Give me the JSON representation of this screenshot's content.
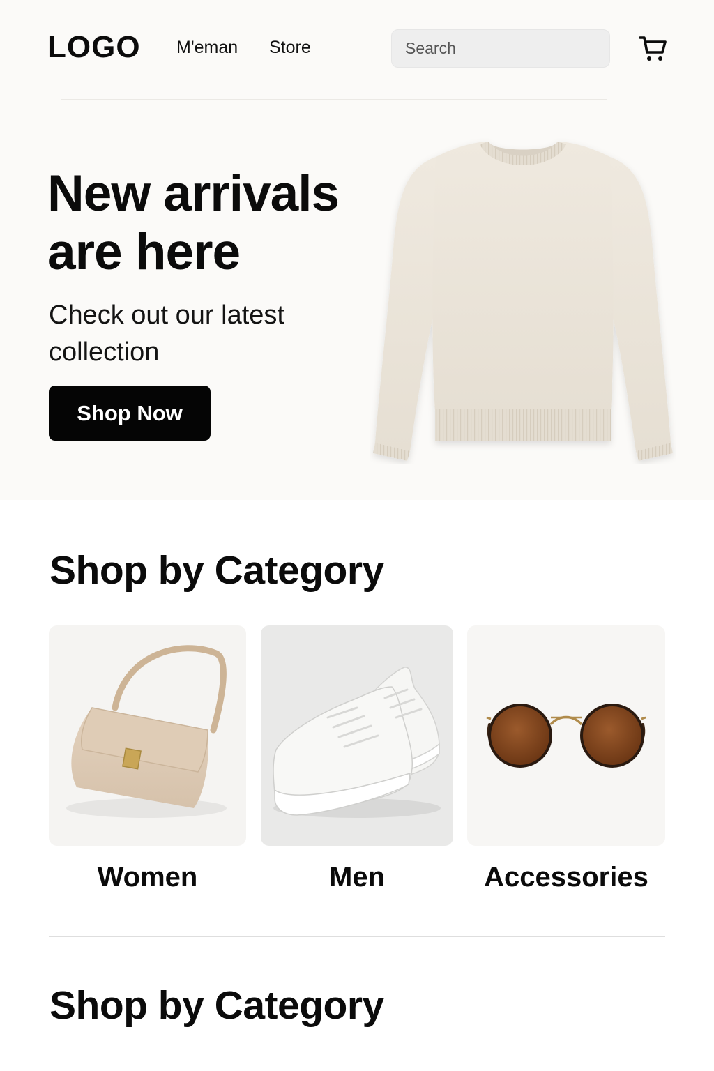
{
  "header": {
    "logo": "LOGO",
    "nav": [
      {
        "label": "M'eman"
      },
      {
        "label": "Store"
      }
    ],
    "search": {
      "placeholder": "Search",
      "value": ""
    },
    "cart_icon": "cart-icon"
  },
  "hero": {
    "title": "New arrivals are here",
    "subtitle": "Check out our latest collection",
    "cta_label": "Shop Now",
    "image": "sweater-image"
  },
  "categories_section": {
    "title": "Shop by Category",
    "items": [
      {
        "label": "Women",
        "image": "handbag-image"
      },
      {
        "label": "Men",
        "image": "sneakers-image"
      },
      {
        "label": "Accessories",
        "image": "sunglasses-image"
      }
    ]
  },
  "second_section": {
    "title": "Shop by Category"
  },
  "colors": {
    "hero_background": "#fbfaf8",
    "button_background": "#050505",
    "button_text": "#ffffff",
    "search_background": "#eeeeee"
  }
}
